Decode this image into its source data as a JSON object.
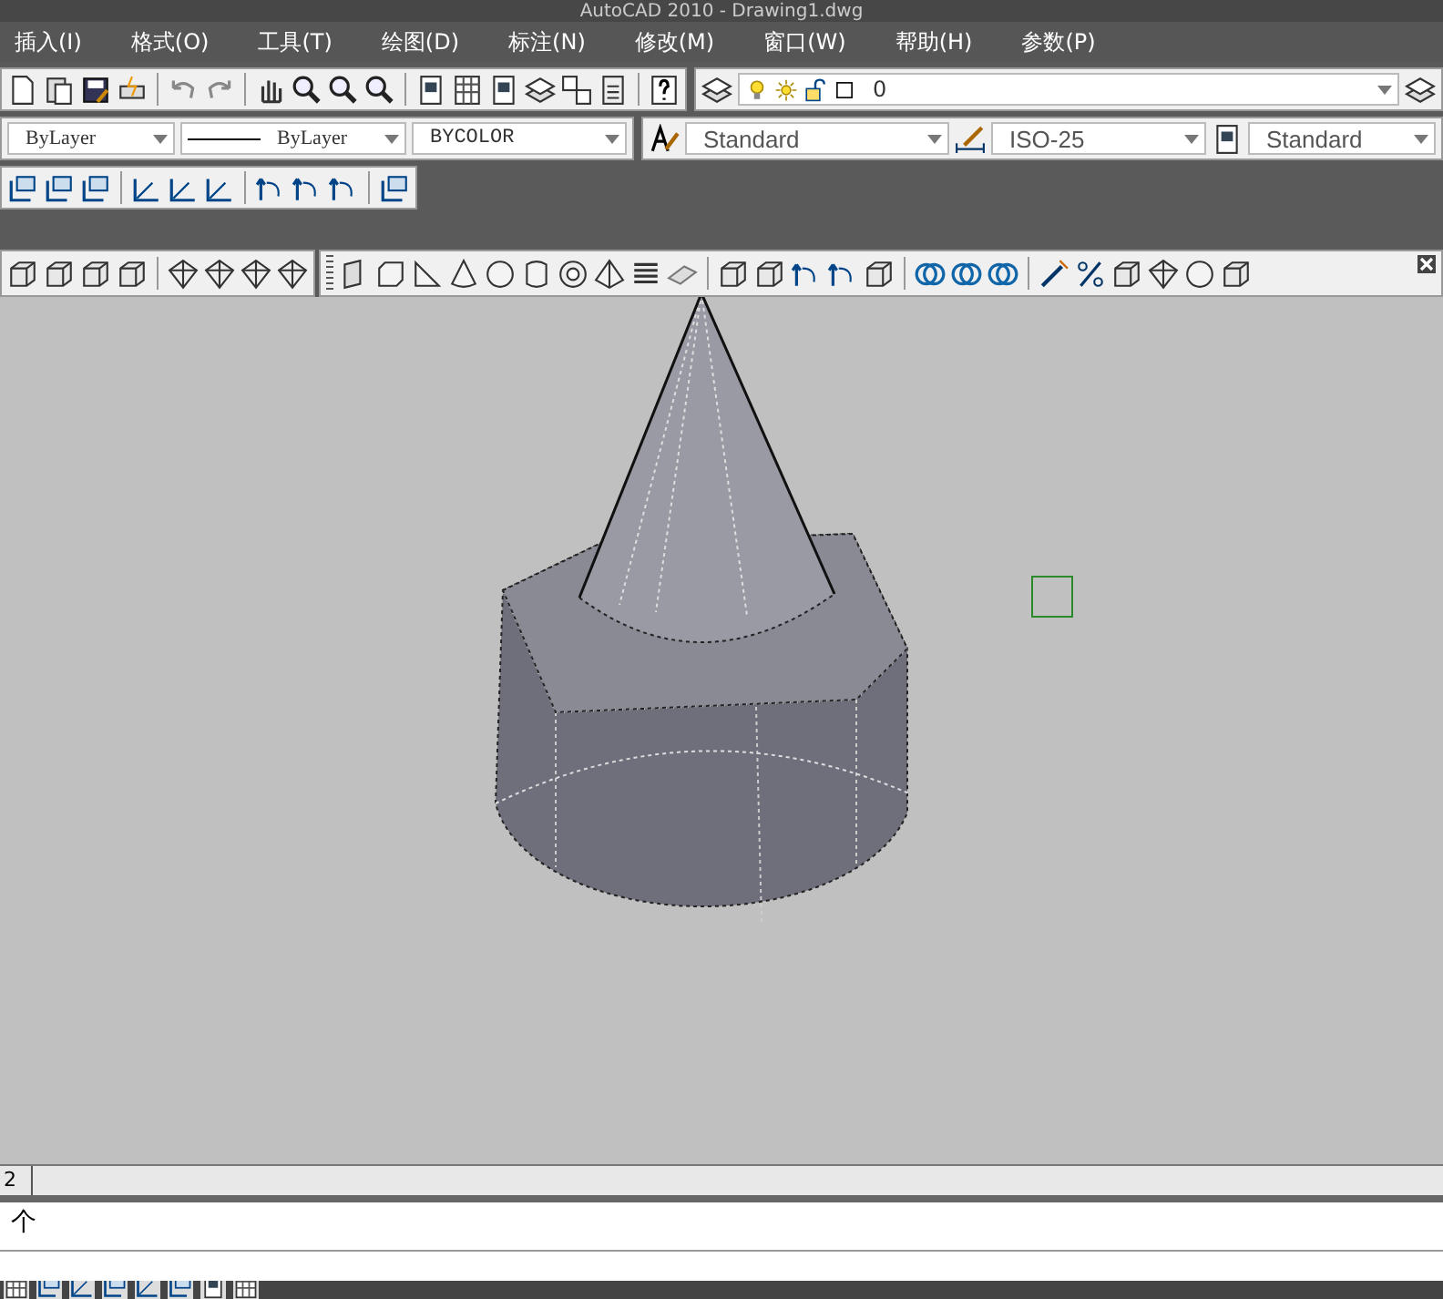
{
  "window": {
    "title": "AutoCAD 2010 - Drawing1.dwg"
  },
  "menu": [
    {
      "label": "插入(I)"
    },
    {
      "label": "格式(O)"
    },
    {
      "label": "工具(T)"
    },
    {
      "label": "绘图(D)"
    },
    {
      "label": "标注(N)"
    },
    {
      "label": "修改(M)"
    },
    {
      "label": "窗口(W)"
    },
    {
      "label": "帮助(H)"
    },
    {
      "label": "参数(P)"
    }
  ],
  "layer_field": {
    "value": "0"
  },
  "properties": {
    "color_control": "ByLayer",
    "linetype": "ByLayer",
    "lineweight": "BYCOLOR"
  },
  "styles": {
    "text_style": "Standard",
    "dim_style": "ISO-25",
    "table_style": "Standard"
  },
  "layout_tabs": [
    {
      "label": "2"
    }
  ],
  "command_line": {
    "text": "个"
  }
}
